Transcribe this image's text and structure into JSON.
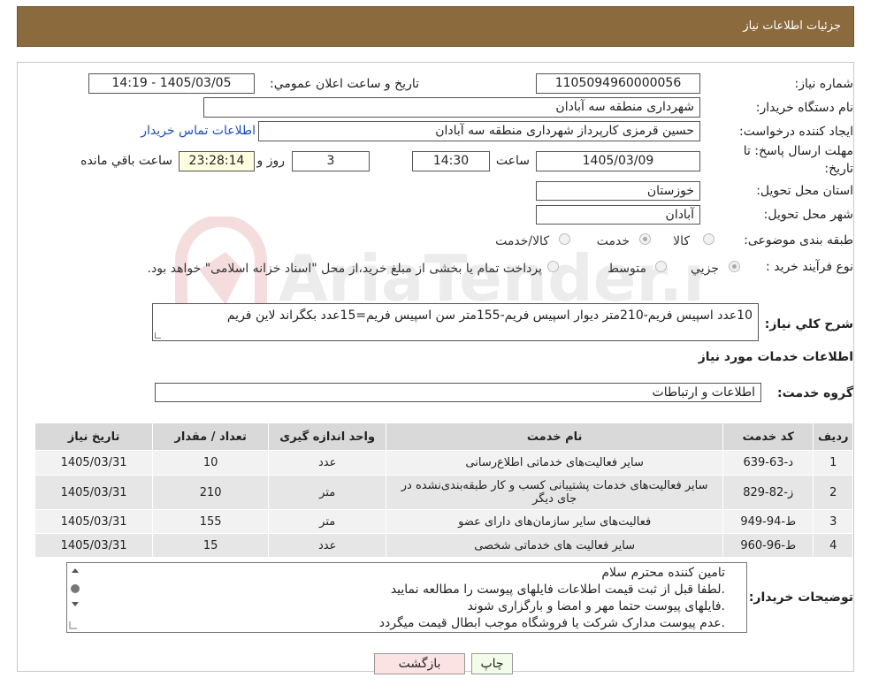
{
  "header": {
    "title": "جزئیات اطلاعات نیاز"
  },
  "fields": {
    "need_number_label": "شماره نیاز:",
    "need_number": "1105094960000056",
    "announce_label": "تاريخ و ساعت اعلان عمومي:",
    "announce_value": "1405/03/05 - 14:19",
    "buyer_org_label": "نام دستگاه خریدار:",
    "buyer_org": "شهرداری منطقه سه آبادان",
    "creator_label": "ايجاد کننده درخواست:",
    "creator": "حسین قرمزی کارپرداز شهرداری منطقه سه آبادان",
    "contact_link": "اطلاعات تماس خریدار",
    "deadline_label_1": "مهلت ارسال پاسخ: تا",
    "deadline_label_2": "تاریخ:",
    "deadline_date": "1405/03/09",
    "hour_label": "ساعت",
    "deadline_time": "14:30",
    "days_value": "3",
    "days_label": "روز و",
    "remaining_value": "23:28:14",
    "remaining_label": "ساعت باقي مانده",
    "province_label": "استان محل تحویل:",
    "province": "خوزستان",
    "city_label": "شهر محل تحویل:",
    "city": "آبادان",
    "category_label": "طبقه بندی موضوعی:",
    "category_options": [
      "کالا",
      "خدمت",
      "کالا/خدمت"
    ],
    "category_selected": "خدمت",
    "process_label": "نوع فرآیند خرید :",
    "process_options": [
      "جزیي",
      "متوسط"
    ],
    "process_note": "پرداخت تمام یا بخشی از مبلغ خرید،از محل \"اسناد خزانه اسلامی\" خواهد بود."
  },
  "summary": {
    "label": "شرح کلي نياز:",
    "text": "10عدد اسپیس فریم-210متر دیوار اسپیس فریم-155متر سن اسپیس فریم=15عدد بکگراند لاین فریم"
  },
  "services": {
    "section_title": "اطلاعات خدمات مورد نياز",
    "group_label": "گروه خدمت:",
    "group_value": "اطلاعات و ارتباطات",
    "columns": [
      "ردیف",
      "کد خدمت",
      "نام خدمت",
      "واحد اندازه گیری",
      "تعداد / مقدار",
      "تاریخ نیاز"
    ],
    "rows": [
      {
        "idx": "1",
        "code": "د-63-639",
        "name": "سایر فعالیت‌های خدماتی اطلاع‌رسانی",
        "unit": "عدد",
        "qty": "10",
        "date": "1405/03/31"
      },
      {
        "idx": "2",
        "code": "ز-82-829",
        "name": "سایر فعالیت‌های خدمات پشتیبانی کسب و کار طبقه‌بندی‌نشده در جای دیگر",
        "unit": "متر",
        "qty": "210",
        "date": "1405/03/31"
      },
      {
        "idx": "3",
        "code": "ط-94-949",
        "name": "فعالیت‌های سایر سازمان‌های دارای عضو",
        "unit": "متر",
        "qty": "155",
        "date": "1405/03/31"
      },
      {
        "idx": "4",
        "code": "ط-96-960",
        "name": "سایر فعالیت های خدماتی شخصی",
        "unit": "عدد",
        "qty": "15",
        "date": "1405/03/31"
      }
    ]
  },
  "buyer_notes": {
    "label": "توضیحات خریدار:",
    "lines": [
      "تامین کننده محترم سلام",
      ".لطفا قبل از ثبت قیمت اطلاعات فایلهای پیوست را مطالعه نمایید",
      ".فایلهای پیوست حتما مهر و امضا و بارگزاری شوند",
      ".عدم پیوست مدارک شرکت یا فروشگاه موجب ابطال قیمت میگردد"
    ]
  },
  "buttons": {
    "print": "چاپ",
    "back": "بازگشت"
  },
  "watermark": {
    "text": "AriaTender.neT"
  }
}
